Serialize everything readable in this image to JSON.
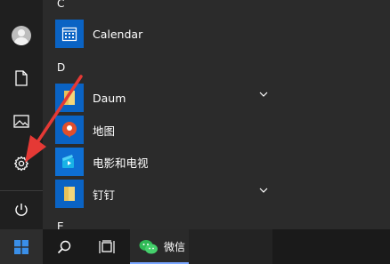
{
  "start_menu": {
    "rail": {
      "items": [
        {
          "name": "user",
          "icon": "user-avatar-icon"
        },
        {
          "name": "documents",
          "icon": "document-icon"
        },
        {
          "name": "pictures",
          "icon": "picture-icon"
        },
        {
          "name": "settings",
          "icon": "gear-icon"
        },
        {
          "name": "power",
          "icon": "power-icon"
        }
      ]
    },
    "groups": [
      {
        "letter": "C"
      },
      {
        "letter": "D"
      },
      {
        "letter": "E"
      }
    ],
    "apps": [
      {
        "label": "Calendar",
        "icon": "calendar-icon"
      },
      {
        "label": "Daum",
        "icon": "folder-icon",
        "expandable": true
      },
      {
        "label": "地图",
        "icon": "maps-pin-icon"
      },
      {
        "label": "电影和电视",
        "icon": "movies-tv-icon"
      },
      {
        "label": "钉钉",
        "icon": "folder-icon",
        "expandable": true
      }
    ]
  },
  "annotation": {
    "color": "#e53935"
  },
  "taskbar": {
    "start_icon": "windows-logo-icon",
    "search_icon": "search-icon",
    "taskview_icon": "task-view-icon",
    "wechat": {
      "label": "微信",
      "icon": "wechat-icon"
    }
  },
  "colors": {
    "accent": "#0a63c4",
    "menu_bg": "#2b2b2b",
    "rail_bg": "#1f1f1f",
    "taskbar_bg": "#1a1a1a"
  }
}
